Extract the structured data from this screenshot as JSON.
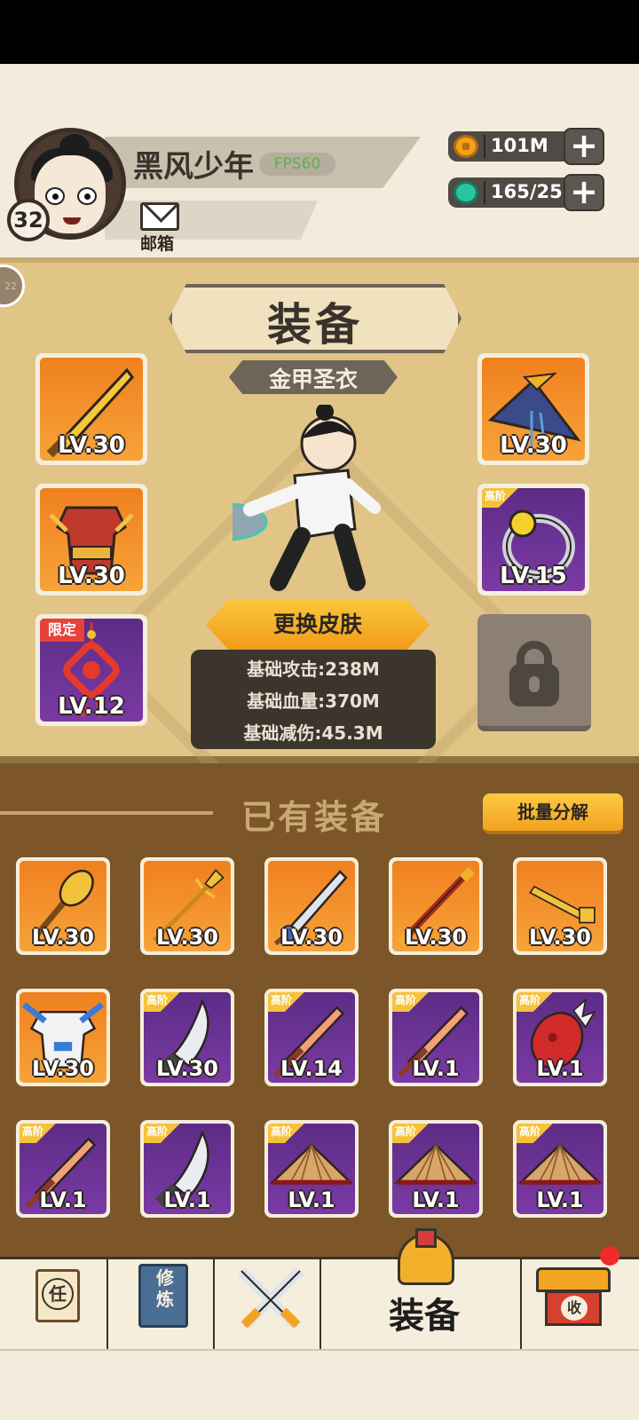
{
  "header": {
    "player_name": "黑风少年",
    "fps": "FPS60",
    "level": "32",
    "mail_label": "邮箱",
    "resources": [
      {
        "icon": "coin-icon",
        "value": "101M"
      },
      {
        "icon": "gem-icon",
        "value": "165/25"
      }
    ],
    "plus_label": "+"
  },
  "equipment": {
    "title": "装备",
    "outfit_name": "金甲圣衣",
    "side_badge": "22",
    "slots": [
      {
        "icon": "golden-sword-icon",
        "level": "LV.30",
        "tier": ""
      },
      {
        "icon": "orange-armor-icon",
        "level": "LV.30",
        "tier": ""
      },
      {
        "icon": "red-knot-charm-icon",
        "level": "LV.12",
        "tier": "限定"
      },
      {
        "icon": "bamboo-hat-icon",
        "level": "LV.30",
        "tier": ""
      },
      {
        "icon": "gold-ring-icon",
        "level": "LV.15",
        "tier": "高阶"
      }
    ],
    "change_skin_label": "更换皮肤",
    "stats": [
      "基础攻击:238M",
      "基础血量:370M",
      "基础减伤:45.3M"
    ]
  },
  "owned": {
    "title": "已有装备",
    "batch_label": "批量分解",
    "items": [
      {
        "icon": "golden-mace-icon",
        "level": "LV.30",
        "tier": "",
        "rarity": "orange"
      },
      {
        "icon": "spear-icon",
        "level": "LV.30",
        "tier": "",
        "rarity": "orange"
      },
      {
        "icon": "blue-sword-icon",
        "level": "LV.30",
        "tier": "",
        "rarity": "orange"
      },
      {
        "icon": "red-staff-icon",
        "level": "LV.30",
        "tier": "",
        "rarity": "orange"
      },
      {
        "icon": "golden-key-icon",
        "level": "LV.30",
        "tier": "",
        "rarity": "orange"
      },
      {
        "icon": "white-armor-icon",
        "level": "LV.30",
        "tier": "",
        "rarity": "orange"
      },
      {
        "icon": "broadsword-icon",
        "level": "LV.30",
        "tier": "高阶",
        "rarity": "purple"
      },
      {
        "icon": "wooden-sword-icon",
        "level": "LV.14",
        "tier": "高阶",
        "rarity": "purple"
      },
      {
        "icon": "wooden-sword-icon",
        "level": "LV.1",
        "tier": "高阶",
        "rarity": "purple"
      },
      {
        "icon": "red-gauntlet-icon",
        "level": "LV.1",
        "tier": "高阶",
        "rarity": "purple"
      },
      {
        "icon": "wooden-sword-icon",
        "level": "LV.1",
        "tier": "高阶",
        "rarity": "purple"
      },
      {
        "icon": "broadsword-icon",
        "level": "LV.1",
        "tier": "高阶",
        "rarity": "purple"
      },
      {
        "icon": "straw-hat-icon",
        "level": "LV.1",
        "tier": "高阶",
        "rarity": "purple"
      },
      {
        "icon": "straw-hat-icon",
        "level": "LV.1",
        "tier": "高阶",
        "rarity": "purple"
      },
      {
        "icon": "straw-hat-icon",
        "level": "LV.1",
        "tier": "高阶",
        "rarity": "purple"
      }
    ]
  },
  "nav": {
    "task": "任",
    "cultivate": "修炼",
    "equip": "装备",
    "collect": "收"
  },
  "colors": {
    "orange_tile": "#f0801f",
    "purple_tile": "#5d2c86",
    "panel": "#e0c587",
    "owned_bg": "#7c5628",
    "accent": "#f2a320"
  }
}
